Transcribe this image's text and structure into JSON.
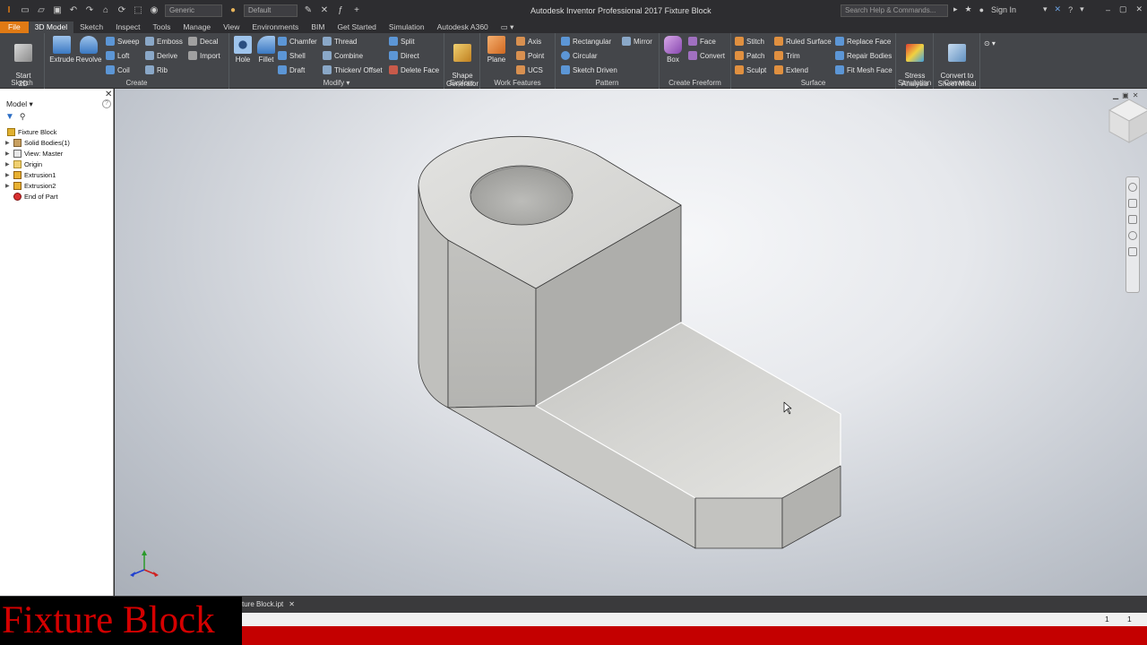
{
  "app": {
    "title": "Autodesk Inventor Professional 2017   Fixture Block",
    "search_placeholder": "Search Help & Commands...",
    "sign_in": "Sign In",
    "appearance": "Generic",
    "material": "Default"
  },
  "tabs": [
    "File",
    "3D Model",
    "Sketch",
    "Inspect",
    "Tools",
    "Manage",
    "View",
    "Environments",
    "BIM",
    "Get Started",
    "Simulation",
    "Autodesk A360"
  ],
  "ribbon": {
    "sketch": {
      "label": "Sketch",
      "start": "Start\n2D Sketch"
    },
    "create": {
      "label": "Create",
      "extrude": "Extrude",
      "revolve": "Revolve",
      "sweep": "Sweep",
      "loft": "Loft",
      "coil": "Coil",
      "emboss": "Emboss",
      "derive": "Derive",
      "rib": "Rib",
      "decal": "Decal",
      "import": "Import"
    },
    "modify": {
      "label": "Modify",
      "hole": "Hole",
      "fillet": "Fillet",
      "chamfer": "Chamfer",
      "shell": "Shell",
      "draft": "Draft",
      "thread": "Thread",
      "combine": "Combine",
      "thicken": "Thicken/ Offset",
      "split": "Split",
      "direct": "Direct",
      "delete_face": "Delete Face"
    },
    "explore": {
      "label": "Explore",
      "shape": "Shape\nGenerator"
    },
    "work": {
      "label": "Work Features",
      "plane": "Plane",
      "axis": "Axis",
      "point": "Point",
      "ucs": "UCS"
    },
    "pattern": {
      "label": "Pattern",
      "rectangular": "Rectangular",
      "circular": "Circular",
      "sketch_driven": "Sketch Driven",
      "mirror": "Mirror"
    },
    "freeform": {
      "label": "Create Freeform",
      "box": "Box",
      "face": "Face",
      "convert": "Convert"
    },
    "surface": {
      "label": "Surface",
      "stitch": "Stitch",
      "patch": "Patch",
      "sculpt": "Sculpt",
      "ruled": "Ruled Surface",
      "trim": "Trim",
      "extend": "Extend",
      "replace": "Replace Face",
      "repair": "Repair Bodies",
      "fitmesh": "Fit Mesh Face"
    },
    "simulation": {
      "label": "Simulation",
      "stress": "Stress\nAnalysis"
    },
    "convert": {
      "label": "Convert",
      "sheet": "Convert to\nSheet Metal"
    }
  },
  "browser": {
    "title": "Model",
    "items": [
      {
        "label": "Fixture Block",
        "level": 0,
        "icon": "part-icon"
      },
      {
        "label": "Solid Bodies(1)",
        "level": 1,
        "icon": "solid-bodies-icon"
      },
      {
        "label": "View: Master",
        "level": 1,
        "icon": "view-icon"
      },
      {
        "label": "Origin",
        "level": 1,
        "icon": "folder-icon"
      },
      {
        "label": "Extrusion1",
        "level": 1,
        "icon": "extrusion-icon"
      },
      {
        "label": "Extrusion2",
        "level": 1,
        "icon": "extrusion-icon"
      },
      {
        "label": "End of Part",
        "level": 1,
        "icon": "end-of-part-icon"
      }
    ]
  },
  "doc_tab": "ture Block.ipt",
  "status": {
    "left_num": "1",
    "right_num": "1"
  },
  "overlay_title": "Fixture Block",
  "colors": {
    "accent": "#e07a14",
    "banner": "#c40000",
    "ribbon": "#44464a"
  }
}
